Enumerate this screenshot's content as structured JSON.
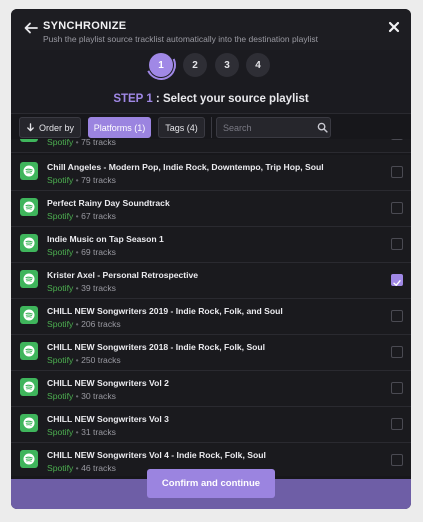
{
  "header": {
    "title": "SYNCHRONIZE",
    "subtitle": "Push the playlist source tracklist automatically into the destination playlist"
  },
  "steps": [
    {
      "label": "1",
      "active": true
    },
    {
      "label": "2",
      "active": false
    },
    {
      "label": "3",
      "active": false
    },
    {
      "label": "4",
      "active": false
    }
  ],
  "step_heading": {
    "prefix": "STEP 1",
    "text": " : Select your source playlist"
  },
  "toolbar": {
    "order_label": "Order by",
    "platforms_label": "Platforms (1)",
    "tags_label": "Tags (4)",
    "search_placeholder": "Search"
  },
  "playlists": [
    {
      "name": "",
      "service": "Spotify",
      "tracks": "75 tracks",
      "checked": false
    },
    {
      "name": "Chill Angeles - Modern Pop, Indie Rock, Downtempo, Trip Hop, Soul",
      "service": "Spotify",
      "tracks": "79 tracks",
      "checked": false
    },
    {
      "name": "Perfect Rainy Day Soundtrack",
      "service": "Spotify",
      "tracks": "67 tracks",
      "checked": false
    },
    {
      "name": "Indie Music on Tap Season 1",
      "service": "Spotify",
      "tracks": "69 tracks",
      "checked": false
    },
    {
      "name": "Krister Axel - Personal Retrospective",
      "service": "Spotify",
      "tracks": "39 tracks",
      "checked": true
    },
    {
      "name": "CHILL NEW Songwriters 2019 - Indie Rock, Folk, and Soul",
      "service": "Spotify",
      "tracks": "206 tracks",
      "checked": false
    },
    {
      "name": "CHILL NEW Songwriters 2018 - Indie Rock, Folk, Soul",
      "service": "Spotify",
      "tracks": "250 tracks",
      "checked": false
    },
    {
      "name": "CHILL NEW Songwriters Vol 2",
      "service": "Spotify",
      "tracks": "30 tracks",
      "checked": false
    },
    {
      "name": "CHILL NEW Songwriters Vol 3",
      "service": "Spotify",
      "tracks": "31 tracks",
      "checked": false
    },
    {
      "name": "CHILL NEW Songwriters Vol 4 - Indie Rock, Folk, Soul",
      "service": "Spotify",
      "tracks": "46 tracks",
      "checked": false
    }
  ],
  "confirm_label": "Confirm and continue",
  "colors": {
    "accent": "#a088e6",
    "spotify_green": "#3fb55c",
    "background": "#17171b"
  }
}
